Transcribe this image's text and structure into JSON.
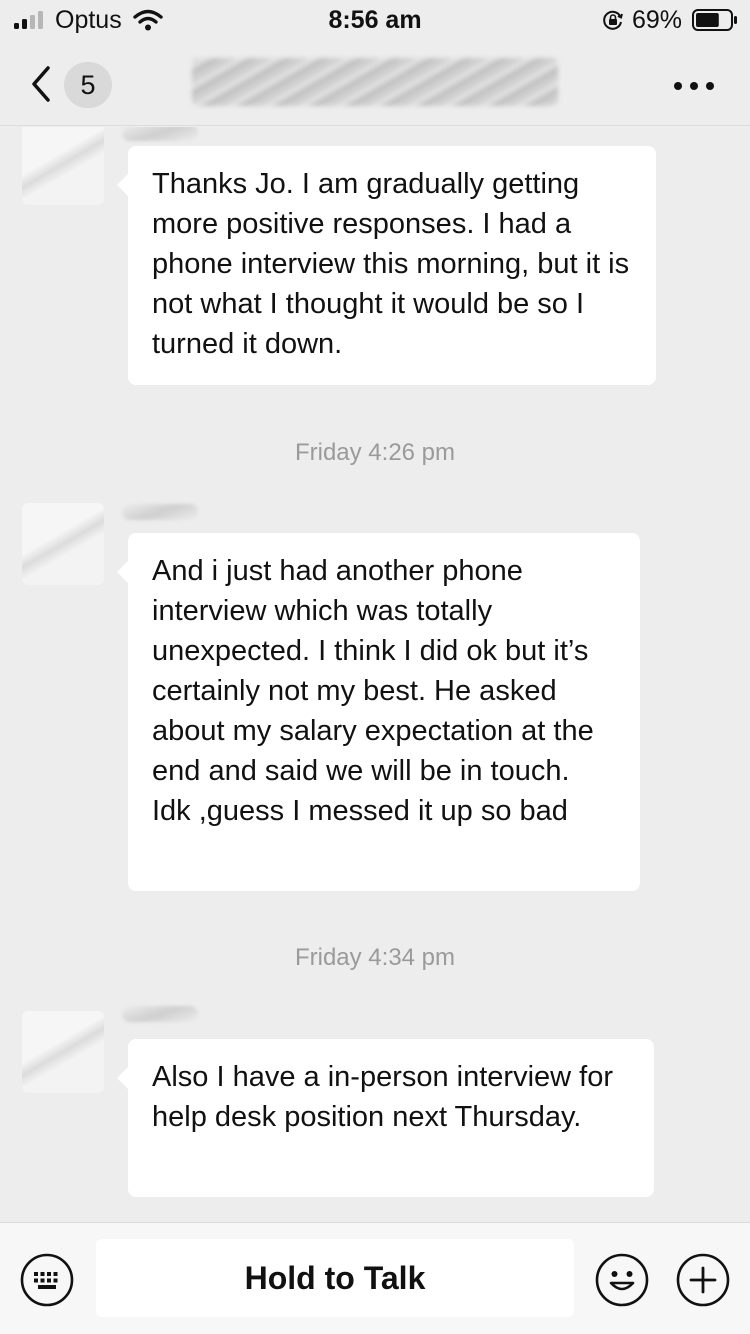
{
  "status_bar": {
    "carrier": "Optus",
    "time": "8:56 am",
    "battery_percent": "69%",
    "battery_level": 0.69,
    "signal_bars_active": 2,
    "signal_bars_total": 4
  },
  "nav": {
    "back_icon": "chevron-left-icon",
    "unread_count": "5",
    "more_icon": "more-dots-icon"
  },
  "messages": [
    {
      "sender": "contact",
      "text": "Thanks Jo. I am gradually getting more positive responses. I had a phone interview this morning, but it is not what I thought it would be so I turned it down."
    },
    {
      "type": "timestamp",
      "text": "Friday 4:26 pm"
    },
    {
      "sender": "contact",
      "text": "And i just had another phone interview which was totally unexpected. I think I did ok but it’s certainly not my best. He asked about my salary expectation at the end and said we will be in touch. Idk ,guess I messed it up so bad"
    },
    {
      "type": "timestamp",
      "text": "Friday 4:34 pm"
    },
    {
      "sender": "contact",
      "text": "Also I have a in-person interview for help desk position next Thursday."
    }
  ],
  "input_bar": {
    "hold_to_talk_label": "Hold to Talk",
    "left_icon": "keyboard-icon",
    "emoji_icon": "emoji-icon",
    "plus_icon": "plus-icon"
  },
  "colors": {
    "background": "#ededed",
    "bubble": "#ffffff",
    "timestamp_text": "#9a9a9a"
  }
}
